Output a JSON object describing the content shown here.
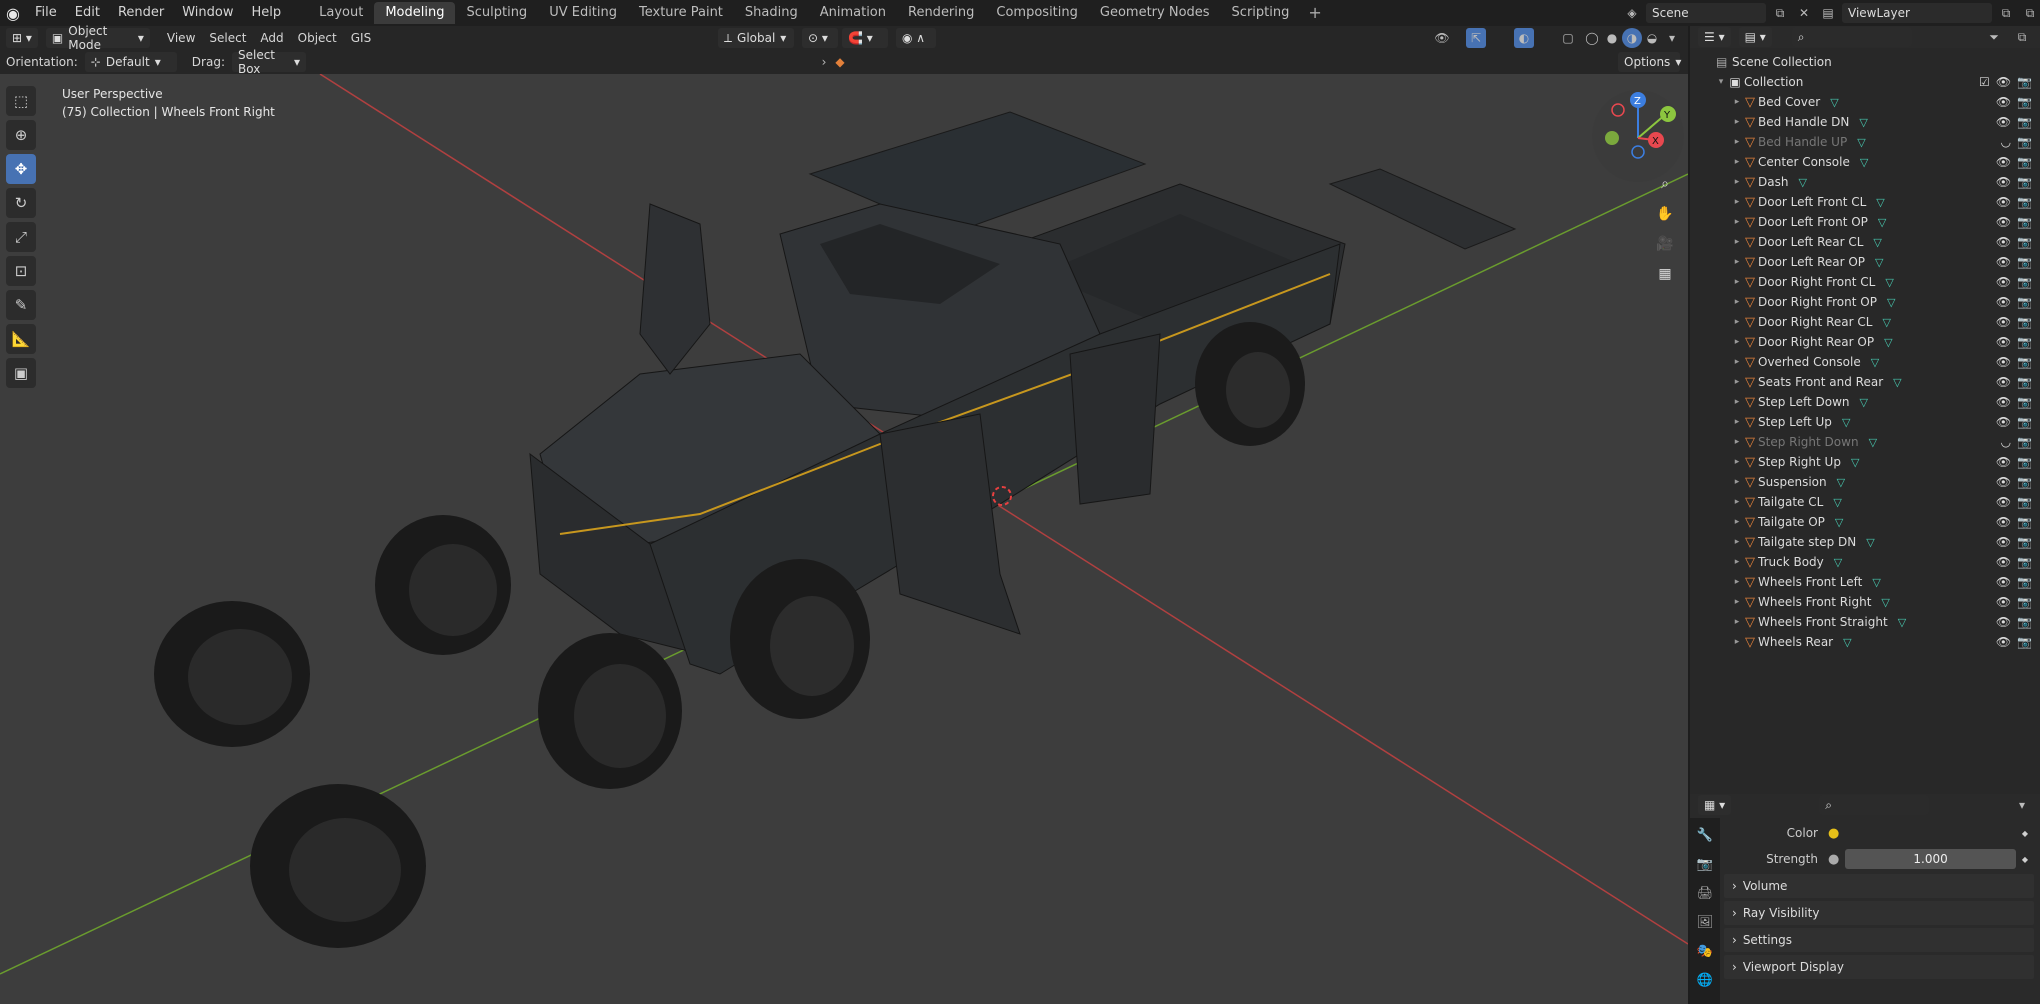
{
  "menu": [
    "File",
    "Edit",
    "Render",
    "Window",
    "Help"
  ],
  "workspaces": [
    "Layout",
    "Modeling",
    "Sculpting",
    "UV Editing",
    "Texture Paint",
    "Shading",
    "Animation",
    "Rendering",
    "Compositing",
    "Geometry Nodes",
    "Scripting"
  ],
  "active_workspace": "Modeling",
  "scene": {
    "name": "Scene",
    "view_layer": "ViewLayer"
  },
  "viewport_header": {
    "mode": "Object Mode",
    "menus": [
      "View",
      "Select",
      "Add",
      "Object",
      "GIS"
    ],
    "transform": "Global",
    "orientation_label": "Orientation:",
    "orientation_value": "Default",
    "drag_label": "Drag:",
    "drag_value": "Select Box",
    "options": "Options"
  },
  "viewport_info": {
    "line1": "User Perspective",
    "line2": "(75) Collection | Wheels Front Right"
  },
  "outliner": {
    "scene_collection": "Scene Collection",
    "collection": "Collection",
    "items": [
      {
        "name": "Bed Cover",
        "dim": false
      },
      {
        "name": "Bed Handle DN",
        "dim": false
      },
      {
        "name": "Bed Handle UP",
        "dim": true
      },
      {
        "name": "Center Console",
        "dim": false
      },
      {
        "name": "Dash",
        "dim": false
      },
      {
        "name": "Door Left Front CL",
        "dim": false
      },
      {
        "name": "Door Left Front OP",
        "dim": false
      },
      {
        "name": "Door Left Rear CL",
        "dim": false
      },
      {
        "name": "Door Left Rear OP",
        "dim": false
      },
      {
        "name": "Door Right Front CL",
        "dim": false
      },
      {
        "name": "Door Right Front OP",
        "dim": false
      },
      {
        "name": "Door Right Rear CL",
        "dim": false
      },
      {
        "name": "Door Right Rear OP",
        "dim": false
      },
      {
        "name": "Overhed Console",
        "dim": false
      },
      {
        "name": "Seats Front and Rear",
        "dim": false
      },
      {
        "name": "Step Left Down",
        "dim": false
      },
      {
        "name": "Step Left Up",
        "dim": false
      },
      {
        "name": "Step Right Down",
        "dim": true
      },
      {
        "name": "Step Right Up",
        "dim": false
      },
      {
        "name": "Suspension",
        "dim": false
      },
      {
        "name": "Tailgate CL",
        "dim": false
      },
      {
        "name": "Tailgate OP",
        "dim": false
      },
      {
        "name": "Tailgate step DN",
        "dim": false
      },
      {
        "name": "Truck Body",
        "dim": false
      },
      {
        "name": "Wheels Front Left",
        "dim": false
      },
      {
        "name": "Wheels Front Right",
        "dim": false
      },
      {
        "name": "Wheels Front Straight",
        "dim": false
      },
      {
        "name": "Wheels Rear",
        "dim": false
      }
    ]
  },
  "properties": {
    "color_label": "Color",
    "strength_label": "Strength",
    "strength_value": "1.000",
    "sections": [
      "Volume",
      "Ray Visibility",
      "Settings",
      "Viewport Display"
    ]
  },
  "gizmo": {
    "z": "Z",
    "y": "Y",
    "x": "X"
  },
  "colors": {
    "accent": "#4772b3",
    "object": "#e2803a",
    "mesh": "#48c9b0",
    "x_axis": "#e8484f",
    "y_axis": "#8cc63f",
    "z_axis": "#3c7ee0"
  }
}
